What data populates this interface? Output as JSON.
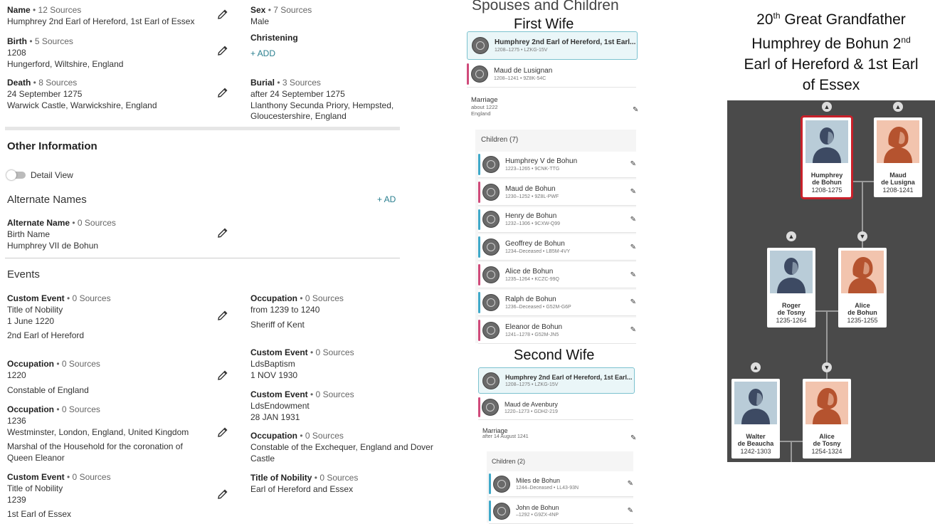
{
  "vitals": {
    "name": {
      "label": "Name",
      "sources": " • 12 Sources",
      "value": "Humphrey 2nd Earl of Hereford, 1st Earl of Essex"
    },
    "sex": {
      "label": "Sex",
      "sources": " • 7 Sources",
      "value": "Male"
    },
    "birth": {
      "label": "Birth",
      "sources": " • 5 Sources",
      "date": "1208",
      "place": "Hungerford, Wiltshire, England"
    },
    "christening": {
      "label": "Christening",
      "add": "+ ADD"
    },
    "death": {
      "label": "Death",
      "sources": " • 8 Sources",
      "date": "24 September 1275",
      "place": "Warwick Castle, Warwickshire, England"
    },
    "burial": {
      "label": "Burial",
      "sources": " • 3 Sources",
      "date": "after 24 September 1275",
      "place1": "Llanthony Secunda Priory, Hempsted,",
      "place2": "Gloucestershire, England"
    }
  },
  "other": {
    "title": "Other Information",
    "detail_view": "Detail View",
    "alt_names_title": "Alternate Names",
    "alt_add": "+ AD",
    "alt": {
      "label": "Alternate Name",
      "sources": " • 0 Sources",
      "type": "Birth Name",
      "value": "Humphrey VII de Bohun"
    },
    "events_title": "Events"
  },
  "events": {
    "e1": {
      "label": "Custom Event",
      "sources": " • 0 Sources",
      "l1": "Title of Nobility",
      "l2": "1 June 1220",
      "l3": "2nd Earl of Hereford"
    },
    "e2": {
      "label": "Occupation",
      "sources": " • 0 Sources",
      "l1": "from 1239 to 1240",
      "l2": "Sheriff of Kent"
    },
    "e3": {
      "label": "Occupation",
      "sources": " • 0 Sources",
      "l1": "1220",
      "l2": "Constable of England"
    },
    "e4": {
      "label": "Custom Event",
      "sources": " • 0 Sources",
      "l1": "LdsBaptism",
      "l2": "1 NOV 1930"
    },
    "e5": {
      "label": "Custom Event",
      "sources": " • 0 Sources",
      "l1": "LdsEndowment",
      "l2": "28 JAN 1931"
    },
    "e6": {
      "label": "Occupation",
      "sources": " • 0 Sources",
      "l1": "1236",
      "l2": "Westminster, London, England, United Kingdom",
      "l3": "Marshal of the Household for the coronation of",
      "l4": "Queen Eleanor"
    },
    "e7": {
      "label": "Occupation",
      "sources": " • 0 Sources",
      "l1": "Constable of the Exchequer, England and Dover",
      "l2": "Castle"
    },
    "e8": {
      "label": "Custom Event",
      "sources": " • 0 Sources",
      "l1": "Title of Nobility",
      "l2": "1239",
      "l3": "1st Earl of Essex"
    },
    "e9": {
      "label": "Title of Nobility",
      "sources": " • 0 Sources",
      "l1": "Earl of Hereford and Essex"
    }
  },
  "spouses": {
    "heading": "Spouses and Children",
    "first_wife": "First Wife",
    "second_wife": "Second Wife",
    "f1": {
      "husband": {
        "name": "Humphrey 2nd Earl of Hereford, 1st Earl...",
        "sub": "1208–1275 • LZKG-15V"
      },
      "wife": {
        "name": "Maud de Lusignan",
        "sub": "1208–1241 • 9Z8K-54C"
      },
      "marriage": {
        "label": "Marriage",
        "date": "about 1222",
        "place": "England"
      },
      "children_label": "Children (7)",
      "children": [
        {
          "name": "Humphrey V de Bohun",
          "sub": "1223–1265 • 9CNK-TTG",
          "color": "#3fa9c9"
        },
        {
          "name": "Maud de Bohun",
          "sub": "1230–1252 • 9Z8L-PWF",
          "color": "#d04a7a"
        },
        {
          "name": "Henry de Bohun",
          "sub": "1232–1306 • 9CXW-Q99",
          "color": "#3fa9c9"
        },
        {
          "name": "Geoffrey de Bohun",
          "sub": "1234–Deceased • LB5M-4VY",
          "color": "#3fa9c9"
        },
        {
          "name": "Alice de Bohun",
          "sub": "1235–1264 • KCZC-99Q",
          "color": "#d04a7a"
        },
        {
          "name": "Ralph de Bohun",
          "sub": "1236–Deceased • G52M-G6P",
          "color": "#3fa9c9"
        },
        {
          "name": "Eleanor de Bohun",
          "sub": "1241–1278 • G52M-JN5",
          "color": "#d04a7a"
        }
      ]
    },
    "f2": {
      "husband": {
        "name": "Humphrey 2nd Earl of Hereford, 1st Earl...",
        "sub": "1208–1275 • LZKG-15V"
      },
      "wife": {
        "name": "Maud de Avenbury",
        "sub": "1220–1273 • GDH2-219"
      },
      "marriage": {
        "label": "Marriage",
        "date": "after 14 August 1241"
      },
      "children_label": "Children (2)",
      "children": [
        {
          "name": "Miles de Bohun",
          "sub": "1244–Deceased • LL43-93N",
          "color": "#3fa9c9"
        },
        {
          "name": "John de Bohun",
          "sub": "–1292 • G9ZX-4NP",
          "color": "#3fa9c9"
        }
      ]
    }
  },
  "tree_title": {
    "rel": "20",
    "rel_sup": "th",
    "rel_rest": " Great Grandfather",
    "name_a": "Humphrey de Bohun 2",
    "name_sup": "nd",
    "name_b": "Earl of Hereford & 1st Earl",
    "name_c": "of Essex"
  },
  "tree": [
    {
      "first": "Humphrey",
      "last": "de Bohun",
      "dates": "1208-1275",
      "sex": "m",
      "selected": true
    },
    {
      "first": "Maud",
      "last": "de Lusigna",
      "dates": "1208-1241",
      "sex": "f"
    },
    {
      "first": "Roger",
      "last": "de Tosny",
      "dates": "1235-1264",
      "sex": "m"
    },
    {
      "first": "Alice",
      "last": "de Bohun",
      "dates": "1235-1255",
      "sex": "f"
    },
    {
      "first": "Walter",
      "last": "de Beaucha",
      "dates": "1242-1303",
      "sex": "m"
    },
    {
      "first": "Alice",
      "last": "de Tosny",
      "dates": "1254-1324",
      "sex": "f"
    }
  ],
  "colors": {
    "male_bg": "#b9ccd8",
    "female_bg": "#f2c4ae",
    "male_fig": "#3d4a63",
    "female_fig": "#b5532f",
    "selected": "#c8202a",
    "accent": "#2a7f8f"
  }
}
